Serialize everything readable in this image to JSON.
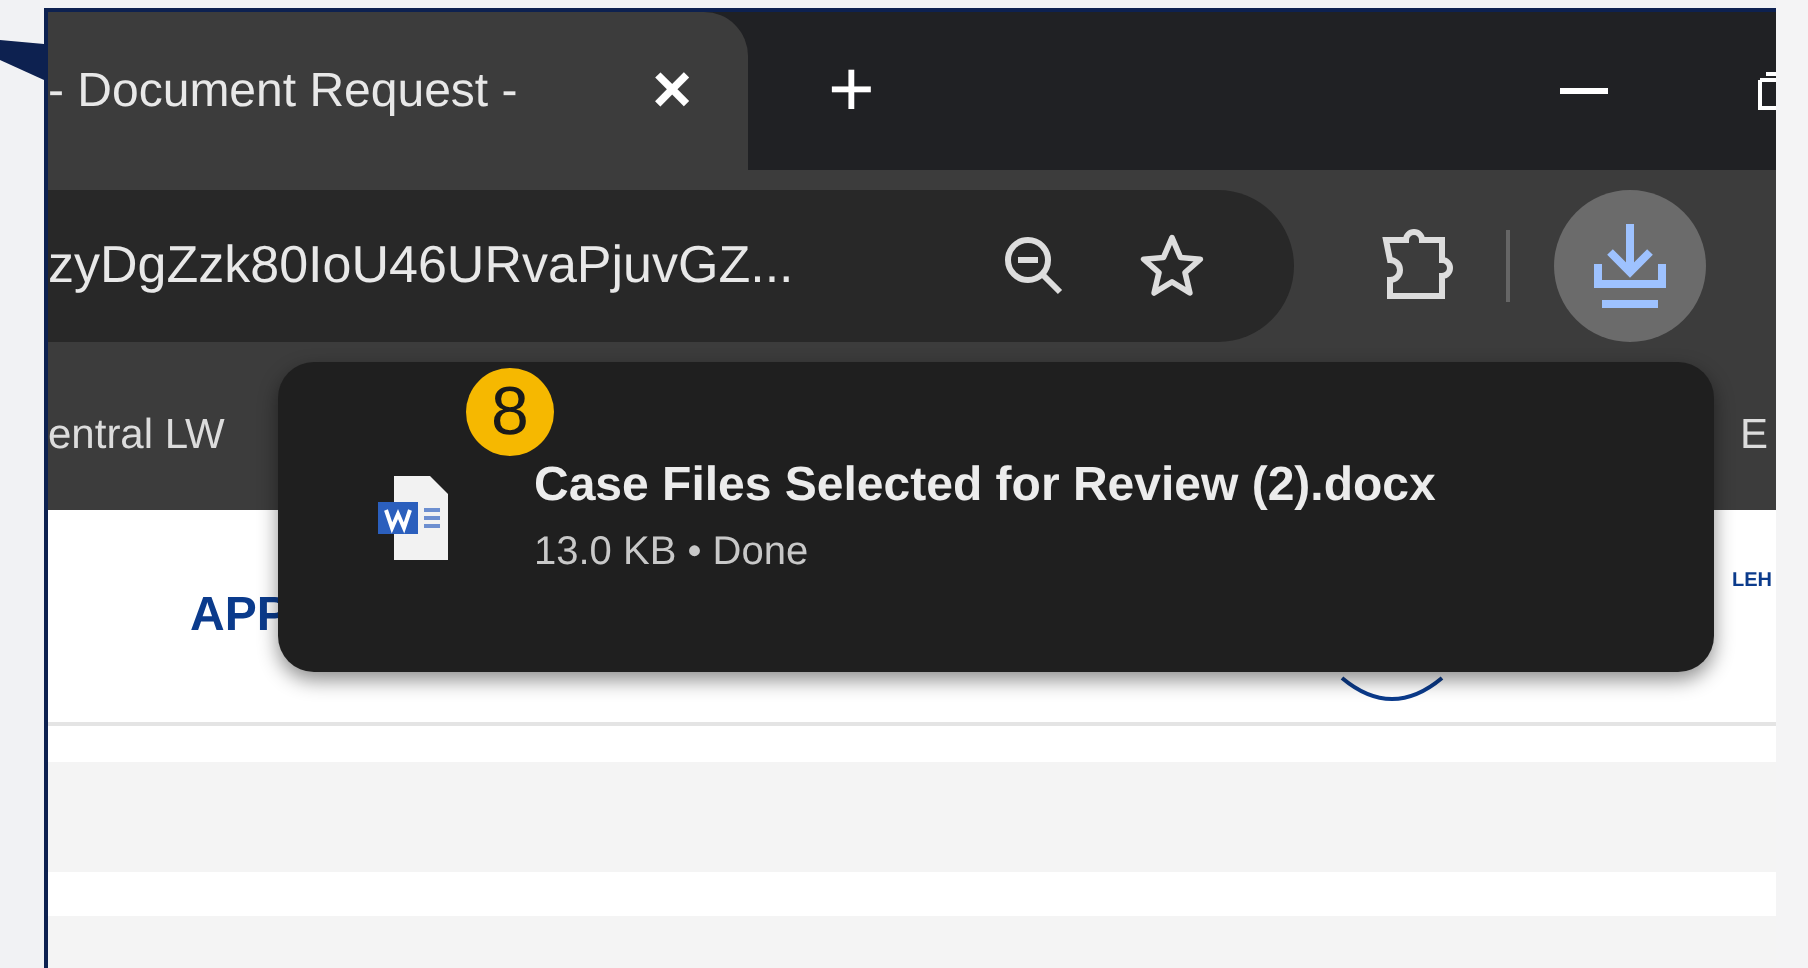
{
  "tab": {
    "title": "- Document Request -",
    "close": "×",
    "selected": true
  },
  "new_tab": "+",
  "address_bar": {
    "url": "zyDgZzk80IoU46URvaPjuvGZ..."
  },
  "bookmarks": [
    "entral LW",
    "E"
  ],
  "page": {
    "heading": "APP",
    "right_label": "LEH"
  },
  "download_popup": {
    "badge": "8",
    "file_name": "Case Files Selected for Review (2).docx",
    "status": "13.0 KB • Done"
  }
}
